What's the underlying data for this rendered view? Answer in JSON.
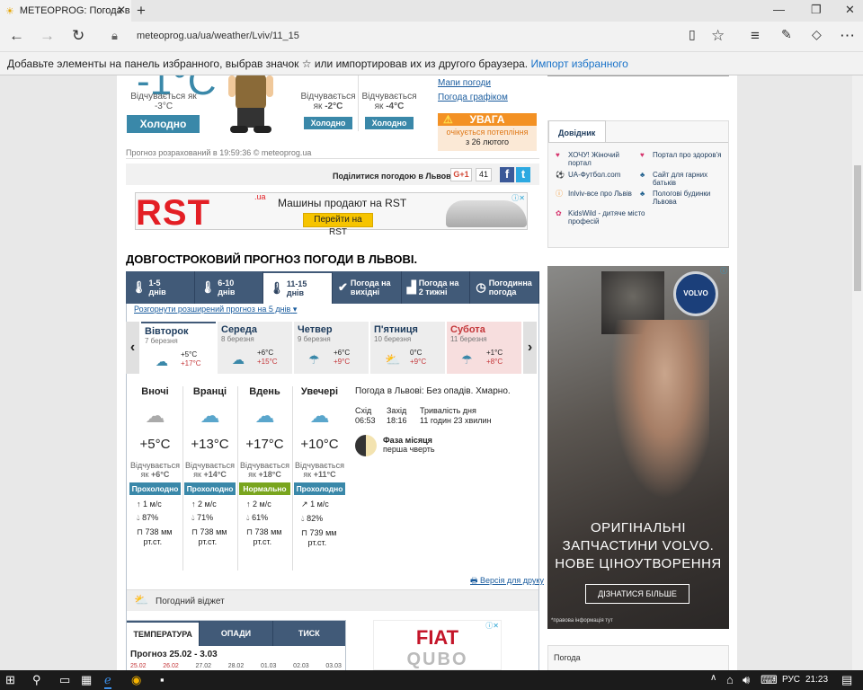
{
  "browser": {
    "tab_title": "METEOPROG: Погода в",
    "url": "meteoprog.ua/ua/weather/Lviv/11_15",
    "favorites_hint": "Добавьте элементы на панель избранного, выбрав значок ☆ или импортировав их из другого браузера.",
    "favorites_link": "Импорт избранного"
  },
  "current": {
    "temp": "-1°C",
    "feels_label": "Відчувається як",
    "feels_value": "-3°C",
    "status": "Холодно",
    "col2_feels_label": "Відчувається",
    "col2_feels_prefix": "як",
    "col2_feels_value": "-2°C",
    "col2_status": "Холодно",
    "col3_feels_label": "Відчувається",
    "col3_feels_prefix": "як",
    "col3_feels_value": "-4°C",
    "col3_status": "Холодно",
    "calc_time": "Прогноз розрахований в 19:59:36 © meteoprog.ua",
    "maps_link": "Мапи погоди",
    "chart_link": "Погода графіком",
    "warning_title": "УВАГА",
    "warning_text1": "очікується потепління",
    "warning_text2": "з 26 лютого"
  },
  "share": {
    "label": "Поділитися погодою в Львові:",
    "gplus": "G+1",
    "count": "41",
    "fb": "f",
    "tw": "t"
  },
  "ad_rst": {
    "logo": "RST",
    "logo_sup": ".ua",
    "text": "Машины продают на RST",
    "button": "Перейти на RST"
  },
  "section_title": "ДОВГОСТРОКОВИЙ ПРОГНОЗ ПОГОДИ В ЛЬВОВІ.",
  "tabs": [
    {
      "l1": "1-5",
      "l2": "днів"
    },
    {
      "l1": "6-10",
      "l2": "днів"
    },
    {
      "l1": "11-15",
      "l2": "днів"
    },
    {
      "l1": "Погода на",
      "l2": "вихідні"
    },
    {
      "l1": "Погода на",
      "l2": "2 тижні"
    },
    {
      "l1": "Погодинна",
      "l2": "погода"
    }
  ],
  "expand_link": "Розгорнути розширений прогноз на 5 днів",
  "days": [
    {
      "name": "Вівторок",
      "date": "7 березня",
      "min": "+5°C",
      "max": "+17°C"
    },
    {
      "name": "Середа",
      "date": "8 березня",
      "min": "+6°C",
      "max": "+15°C"
    },
    {
      "name": "Четвер",
      "date": "9 березня",
      "min": "+6°C",
      "max": "+9°C"
    },
    {
      "name": "П'ятниця",
      "date": "10 березня",
      "min": "0°C",
      "max": "+9°C"
    },
    {
      "name": "Субота",
      "date": "11 березня",
      "min": "+1°C",
      "max": "+8°C"
    }
  ],
  "periods": [
    {
      "name": "Вночі",
      "temp": "+5°C",
      "feels1": "Відчувається",
      "feels2": "як",
      "feels_val": "+6°C",
      "badge": "Прохолодно",
      "wind": "1 м/с",
      "hum": "87%",
      "press1": "738 мм",
      "press2": "рт.ст."
    },
    {
      "name": "Вранці",
      "temp": "+13°C",
      "feels1": "Відчувається",
      "feels2": "як",
      "feels_val": "+14°C",
      "badge": "Прохолодно",
      "wind": "2 м/с",
      "hum": "71%",
      "press1": "738 мм",
      "press2": "рт.ст."
    },
    {
      "name": "Вдень",
      "temp": "+17°C",
      "feels1": "Відчувається",
      "feels2": "як",
      "feels_val": "+18°C",
      "badge": "Нормально",
      "wind": "2 м/с",
      "hum": "61%",
      "press1": "738 мм",
      "press2": "рт.ст."
    },
    {
      "name": "Увечері",
      "temp": "+10°C",
      "feels1": "Відчувається",
      "feels2": "як",
      "feels_val": "+11°C",
      "badge": "Прохолодно",
      "wind": "1 м/с",
      "hum": "82%",
      "press1": "739 мм",
      "press2": "рт.ст."
    }
  ],
  "summary": {
    "text": "Погода в Львові: Без опадів. Хмарно.",
    "sunrise_label": "Схід",
    "sunrise": "06:53",
    "sunset_label": "Захід",
    "sunset": "18:16",
    "daylen_label": "Тривалість дня",
    "daylen": "11 годин 23 хвилин",
    "moon_label": "Фаза місяця",
    "moon_value": "перша чверть"
  },
  "print_link": "Версія для друку",
  "widget_label": "Погодний віджет",
  "bottom_tabs": [
    "ТЕМПЕРАТУРА",
    "ОПАДИ",
    "ТИСК"
  ],
  "bottom_forecast": "Прогноз 25.02 - 3.03",
  "bottom_dates": [
    "25.02",
    "26.02",
    "27.02",
    "28.02",
    "01.03",
    "02.03",
    "03.03"
  ],
  "fiat": {
    "brand": "FIAT",
    "model": "QUBO"
  },
  "sidebar": {
    "title": "Довідник",
    "items": [
      "ХОЧУ! Жіночий портал",
      "Портал про здоров'я",
      "UA-Футбол.com",
      "Сайт для гарних батьків",
      "Inlviv-все про Львів",
      "Пологові будинки Львова",
      "KidsWild - дитяче місто професій"
    ],
    "bottom_title": "Погода"
  },
  "volvo": {
    "brand": "VOLVO",
    "line1": "ОРИГІНАЛЬНІ",
    "line2": "ЗАПЧАСТИНИ VOLVO.",
    "line3": "НОВЕ ЦІНОУТВОРЕННЯ",
    "button": "ДІЗНАТИСЯ БІЛЬШЕ",
    "footnote": "*правова інформація тут"
  },
  "taskbar": {
    "lang": "РУС",
    "time": "21:23"
  }
}
